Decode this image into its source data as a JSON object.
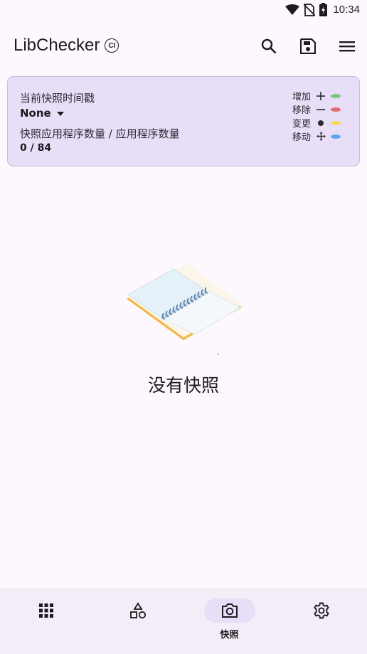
{
  "status_bar": {
    "time": "10:34",
    "icons": [
      "wifi-icon",
      "no-sim-icon",
      "battery-charging-icon"
    ]
  },
  "app_bar": {
    "title": "LibChecker",
    "badge": "CI",
    "actions": [
      "search-icon",
      "save-icon",
      "menu-icon"
    ]
  },
  "snapshot_card": {
    "timestamp_label": "当前快照时间戳",
    "timestamp_value": "None",
    "count_label": "快照应用程序数量 / 应用程序数量",
    "count_value": "0 / 84",
    "legend": [
      {
        "label": "增加",
        "symbol": "+",
        "color": "#7dc47a"
      },
      {
        "label": "移除",
        "symbol": "−",
        "color": "#e06c6c"
      },
      {
        "label": "变更",
        "symbol": "●",
        "color": "#f2d95c"
      },
      {
        "label": "移动",
        "symbol": "✥",
        "color": "#5ea8e8"
      }
    ]
  },
  "empty_state": {
    "message": "没有快照"
  },
  "bottom_nav": {
    "items": [
      {
        "icon": "apps-grid-icon",
        "label": ""
      },
      {
        "icon": "shapes-icon",
        "label": ""
      },
      {
        "icon": "camera-icon",
        "label": "快照",
        "active": true
      },
      {
        "icon": "settings-icon",
        "label": ""
      }
    ]
  },
  "colors": {
    "background": "#fdf7fe",
    "card": "#e9def8",
    "bottom_nav": "#f3edf7",
    "active_pill": "#e8def8"
  }
}
